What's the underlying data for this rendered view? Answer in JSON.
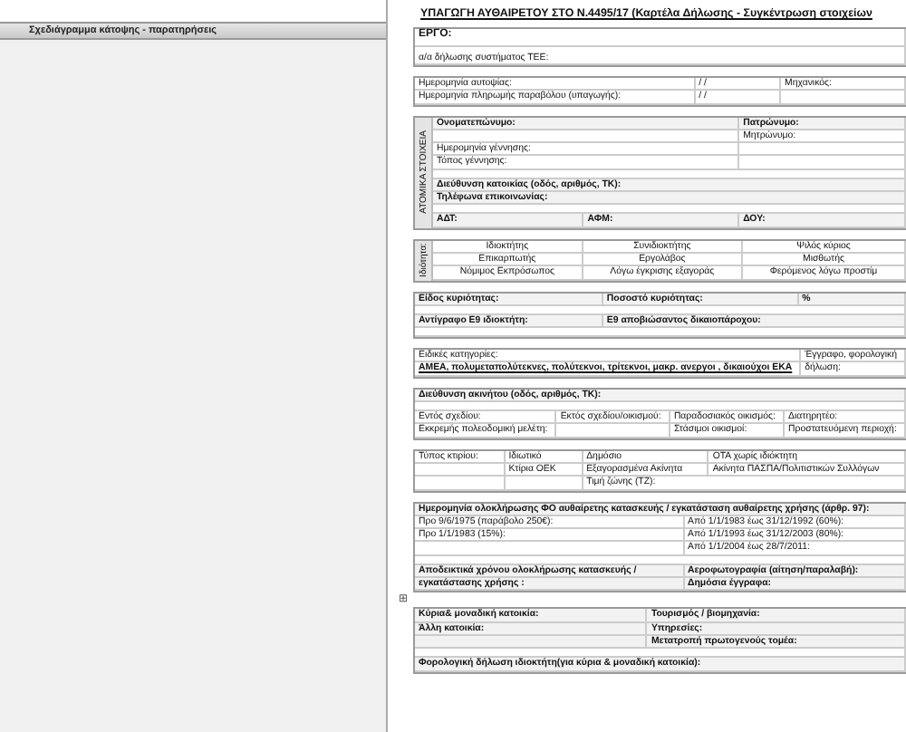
{
  "sidebar": {
    "title": "Σχεδιάγραμμα κάτοψης - παρατηρήσεις"
  },
  "document": {
    "heading": "ΥΠΑΓΩΓΗ ΑΥΘΑΙΡΕΤΟΥ ΣΤΟ Ν.4495/17 (Καρτέλα Δήλωσης - Συγκέντρωση στοιχείων",
    "sections": [
      {
        "rows": [
          {
            "kind": "title",
            "cells": [
              "ΕΡΓΟ:"
            ]
          },
          {
            "kind": "tall",
            "cells": [
              "α/α δήλωσης συστήματος ΤΕΕ:"
            ]
          }
        ]
      },
      {
        "rows": [
          {
            "kind": "plain",
            "cells": [
              "Ημερομηνία αυτοψίας:",
              "/   /",
              "Μηχανικός:"
            ]
          },
          {
            "kind": "plain",
            "cells": [
              "Ημερομηνία πληρωμής παραβόλου (υπαγωγής):",
              "/   /",
              null
            ]
          }
        ]
      },
      {
        "side_label": "ΑΤΟΜΙΚΑ ΣΤΟΙΧΕΙΑ",
        "rows": [
          {
            "kind": "head",
            "cells": [
              "Ονοματεπώνυμο:",
              "Πατρώνυμο:"
            ]
          },
          {
            "kind": "plain",
            "cells": [
              null,
              "Μητρώνυμο:"
            ]
          },
          {
            "kind": "plain",
            "cells": [
              "Ημερομηνία γέννησης:",
              null
            ]
          },
          {
            "kind": "plain",
            "cells": [
              "Τόπος γέννησης:",
              null
            ]
          },
          {
            "kind": "blank",
            "cells": [
              null
            ]
          },
          {
            "kind": "head",
            "cells": [
              "Διεύθυνση κατοικίας (οδός, αριθμός, ΤΚ):"
            ]
          },
          {
            "kind": "head",
            "cells": [
              "Τηλέφωνα επικοινωνίας:"
            ]
          },
          {
            "kind": "blank",
            "cells": [
              null
            ]
          },
          {
            "kind": "head",
            "cells": [
              "ΑΔΤ:",
              "ΑΦΜ:",
              "ΔΟΥ:"
            ]
          }
        ]
      },
      {
        "side_label": "Ιδιότητα:",
        "rows": [
          {
            "kind": "center",
            "cells": [
              "Ιδιοκτήτης",
              "Συνιδιοκτήτης",
              "Ψιλός κύριος"
            ]
          },
          {
            "kind": "center",
            "cells": [
              "Επικαρπωτής",
              "Εργολάβος",
              "Μισθωτής"
            ]
          },
          {
            "kind": "center",
            "cells": [
              "Νόμιμος Εκπρόσωπος",
              "Λόγω έγκρισης εξαγοράς",
              "Φερόμενος λόγω προστίμ"
            ]
          }
        ]
      },
      {
        "rows": [
          {
            "kind": "head",
            "cells": [
              "Είδος κυριότητας:",
              "Ποσοστό κυριότητας:",
              "%"
            ]
          },
          {
            "kind": "blank",
            "cells": [
              null
            ]
          },
          {
            "kind": "head",
            "cells": [
              "Αντίγραφο Ε9 ιδιοκτήτη:",
              "Ε9 αποβιώσαντος δικαιοπάροχου:"
            ]
          },
          {
            "kind": "blank",
            "cells": [
              null
            ]
          }
        ]
      },
      {
        "rows": [
          {
            "kind": "plain",
            "cells": [
              "Ειδικές κατηγορίες:",
              "Έγγραφο, φορολογική"
            ]
          },
          {
            "kind": "emph",
            "cells": [
              "ΑΜΕΑ, πολυμεταπολύτεκνες, πολύτεκνοι, τρίτεκνοι, μακρ. ανεργοι , δικαιούχοι ΕΚΑ",
              "δήλωση:"
            ]
          }
        ]
      },
      {
        "rows": [
          {
            "kind": "head",
            "cells": [
              "Διεύθυνση ακινήτου (οδός, αριθμός, ΤΚ):"
            ]
          },
          {
            "kind": "blank",
            "cells": [
              null
            ]
          },
          {
            "kind": "plain",
            "cells": [
              "Εντός σχεδίου:",
              "Εκτός σχεδίου/οικισμού:",
              "Παραδοσιακός οικισμός:",
              "Διατηρητέο:"
            ]
          },
          {
            "kind": "plain",
            "cells": [
              "Εκκρεμής πολεοδομική μελέτη:",
              null,
              "Στάσιμοι οικισμοί:",
              "Προστατευόμενη περιοχή:"
            ]
          }
        ]
      },
      {
        "rows": [
          {
            "kind": "plain",
            "cells": [
              "Τύπος κτιρίου:",
              "Ιδιωτικό",
              "Δημόσιο",
              "ΟΤΑ χωρίς ιδιόκτητη"
            ]
          },
          {
            "kind": "plain",
            "cells": [
              null,
              "Κτίρια ΟΕΚ",
              "Εξαγορασμένα Ακίνητα",
              "Ακίνητα ΠΑΣΠΑ/Πολιτιστικών Συλλόγων"
            ]
          },
          {
            "kind": "plain",
            "cells": [
              null,
              null,
              "Τιμή ζώνης (ΤΖ):"
            ]
          }
        ]
      },
      {
        "rows": [
          {
            "kind": "head",
            "cells": [
              "Ημερομηνία ολοκλήρωσης ΦΟ αυθαίρετης κατασκευής / εγκατάσταση  αυθαίρετης χρήσης (άρθρ. 97):"
            ]
          },
          {
            "kind": "plain",
            "cells": [
              "Προ 9/6/1975 (παράβολο 250€):",
              "Από 1/1/1983 έως 31/12/1992 (60%):"
            ]
          },
          {
            "kind": "plain",
            "cells": [
              "Προ 1/1/1983 (15%):",
              "Από 1/1/1993 έως 31/12/2003 (80%):"
            ]
          },
          {
            "kind": "plain",
            "cells": [
              null,
              "Από 1/1/2004 έως 28/7/2011:"
            ]
          },
          {
            "kind": "blank",
            "cells": [
              null
            ]
          },
          {
            "kind": "head",
            "cells": [
              "Αποδεικτικά χρόνου ολοκλήρωσης κατασκευής /",
              "Αεροφωτογραφία (αίτηση/παραλαβή):"
            ]
          },
          {
            "kind": "head",
            "cells": [
              "εγκατάστασης χρήσης :",
              "Δημόσια έγγραφα:"
            ]
          }
        ]
      },
      {
        "handle": "⊞",
        "rows": [
          {
            "kind": "head",
            "cells": [
              "Κύρια& μοναδική  κατοικία:",
              "Τουρισμός / βιομηχανία:"
            ]
          },
          {
            "kind": "head",
            "cells": [
              "Άλλη κατοικία:",
              "Υπηρεσίες:"
            ]
          },
          {
            "kind": "head",
            "cells": [
              null,
              "Μετατροπή πρωτογενούς τομέα:"
            ]
          },
          {
            "kind": "blank",
            "cells": [
              null
            ]
          },
          {
            "kind": "head",
            "cells": [
              "Φορολογική δήλωση ιδιοκτήτη(για κύρια & μοναδική κατοικία):"
            ]
          }
        ]
      }
    ]
  }
}
